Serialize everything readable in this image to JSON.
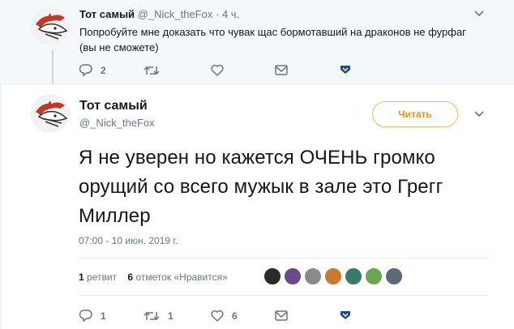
{
  "parent_tweet": {
    "name": "Тот самый",
    "handle": "@_Nick_theFox",
    "separator": "·",
    "time": "4 ч.",
    "text": "Попробуйте мне доказать что чувак щас бормотавший на драконов не фурфаг (вы не сможете)",
    "reply_count": "2",
    "retweet_count": "",
    "like_count": ""
  },
  "main_tweet": {
    "name": "Тот самый",
    "handle": "@_Nick_theFox",
    "follow_label": "Читать",
    "text": "Я не уверен но кажется ОЧЕНЬ громко орущий со всего мужык в зале это Грегг Миллер",
    "date": "07:00 - 10 июн. 2019 г.",
    "stats": {
      "retweets_count": "1",
      "retweets_label": "ретвит",
      "likes_count": "6",
      "likes_label": "отметок «Нравится»"
    },
    "reply_count": "1",
    "retweet_count": "1",
    "like_count": "6"
  },
  "icons": {
    "reply": "reply-icon",
    "retweet": "retweet-icon",
    "like": "heart-icon",
    "dm": "envelope-icon",
    "more": "chevron-down-icon",
    "bookmark": "bookmark-icon"
  },
  "colors": {
    "accent": "#e8960f",
    "follow_border": "#f5b85a",
    "muted": "#657786",
    "text": "#14171a",
    "parent_bg": "#f5f8fa",
    "bookmark": "#1c4f7a"
  },
  "likers": [
    {
      "color": "#2a2a2a"
    },
    {
      "color": "#6b4a8a"
    },
    {
      "color": "#8a8a8a"
    },
    {
      "color": "#c9782c"
    },
    {
      "color": "#3a7a6a"
    },
    {
      "color": "#6aa84f"
    },
    {
      "color": "#5a6a7a"
    }
  ]
}
